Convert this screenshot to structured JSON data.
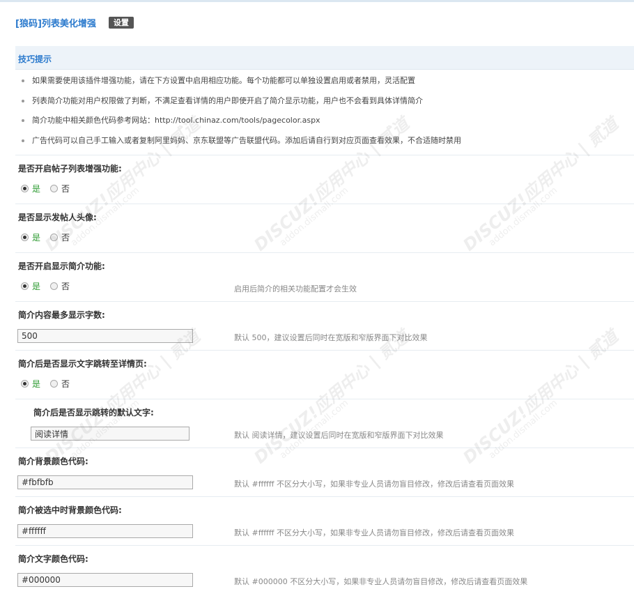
{
  "header": {
    "plugin_title": "[狼码]列表美化增强",
    "settings_badge": "设置"
  },
  "tips": {
    "title": "技巧提示",
    "items": [
      "如果需要使用该插件增强功能，请在下方设置中启用相应功能。每个功能都可以单独设置启用或者禁用，灵活配置",
      "列表简介功能对用户权限做了判断，不满足查看详情的用户即使开启了简介显示功能，用户也不会看到具体详情简介",
      "简介功能中相关颜色代码参考网站：http://tool.chinaz.com/tools/pagecolor.aspx",
      "广告代码可以自己手工输入或者复制阿里妈妈、京东联盟等广告联盟代码。添加后请自行到对应页面查看效果，不合适随时禁用"
    ]
  },
  "settings": [
    {
      "label": "是否开启帖子列表增强功能:",
      "type": "radio",
      "yes": "是",
      "no": "否",
      "selected": "是",
      "hint": ""
    },
    {
      "label": "是否显示发帖人头像:",
      "type": "radio",
      "yes": "是",
      "no": "否",
      "selected": "是",
      "hint": ""
    },
    {
      "label": "是否开启显示简介功能:",
      "type": "radio",
      "yes": "是",
      "no": "否",
      "selected": "是",
      "hint": "启用后简介的相关功能配置才会生效"
    },
    {
      "label": "简介内容最多显示字数:",
      "type": "text",
      "value": "500",
      "hint": "默认 500，建议设置后同时在宽版和窄版界面下对比效果"
    },
    {
      "label": "简介后是否显示文字跳转至详情页:",
      "type": "radio",
      "yes": "是",
      "no": "否",
      "selected": "是",
      "hint": ""
    },
    {
      "label": "简介后是否显示跳转的默认文字:",
      "type": "text",
      "value": "阅读详情",
      "hint": "默认 阅读详情，建议设置后同时在宽版和窄版界面下对比效果"
    },
    {
      "label": "简介背景颜色代码:",
      "type": "text",
      "value": "#fbfbfb",
      "hint": "默认 #ffffff 不区分大小写，如果非专业人员请勿盲目修改，修改后请查看页面效果"
    },
    {
      "label": "简介被选中时背景颜色代码:",
      "type": "text",
      "value": "#ffffff",
      "hint": "默认 #ffffff 不区分大小写，如果非专业人员请勿盲目修改，修改后请查看页面效果"
    },
    {
      "label": "简介文字颜色代码:",
      "type": "text",
      "value": "#000000",
      "hint": "默认 #000000 不区分大小写，如果非专业人员请勿盲目修改，修改后请查看页面效果"
    }
  ],
  "watermark": {
    "brand": "DISCUZ!应用中心 | 贰道",
    "domain": "addon.dismall.com"
  },
  "colors": {
    "accent_blue": "#2b7acd",
    "yes_green": "#2f9b33",
    "tips_bg": "#edf3f9"
  }
}
